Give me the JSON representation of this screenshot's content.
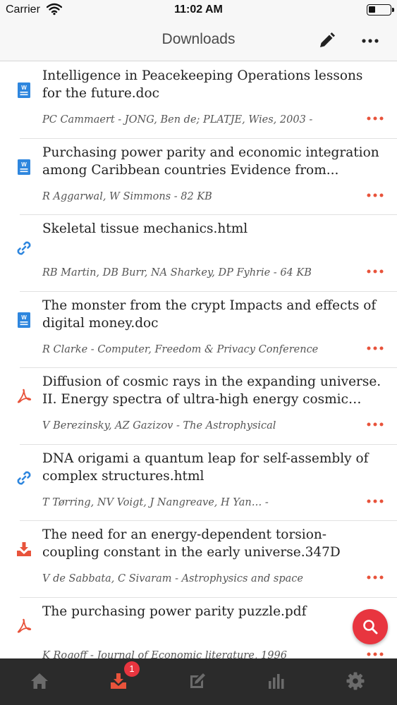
{
  "status_bar": {
    "carrier": "Carrier",
    "time": "11:02 AM"
  },
  "nav": {
    "title": "Downloads",
    "edit_icon": "pencil-icon",
    "more_icon": "more-horizontal-icon"
  },
  "colors": {
    "accent": "#e8533b",
    "fab": "#e8353f",
    "doc_blue": "#2e86de",
    "tabbar": "#2b2b2b"
  },
  "items": [
    {
      "type": "doc",
      "title": " Intelligence in Peacekeeping Operations  lessons for the future.doc",
      "meta": "PC Cammaert - JONG, Ben de; PLATJE, Wies, 2003 -"
    },
    {
      "type": "doc",
      "title": " Purchasing power parity and economic integration among Caribbean countries  Evidence from...",
      "meta": "R Aggarwal, W Simmons - 82 KB"
    },
    {
      "type": "link",
      "title": " Skeletal tissue mechanics.html",
      "meta": "RB Martin, DB Burr, NA Sharkey, DP Fyhrie - 64 KB"
    },
    {
      "type": "doc",
      "title": " The monster from the crypt  Impacts and effects of digital money.doc",
      "meta": "R Clarke - Computer, Freedom & Privacy Conference"
    },
    {
      "type": "pdf",
      "title": "Diffusion of cosmic rays in the expanding universe. II. Energy spectra of ultra-high energy cosmic rays...",
      "meta": "V Berezinsky, AZ Gazizov - The Astrophysical"
    },
    {
      "type": "link",
      "title": "DNA origami  a quantum leap for self-assembly of complex structures.html",
      "meta": "T Tørring, NV Voigt, J Nangreave, H Yan… -"
    },
    {
      "type": "download",
      "title": "The need for an energy-dependent torsion-coupling constant in the early universe.347D",
      "meta": "V de Sabbata, C Sivaram - Astrophysics and space"
    },
    {
      "type": "pdf",
      "title": "The purchasing power parity puzzle.pdf",
      "meta": "K Rogoff - Journal of Economic literature, 1996"
    }
  ],
  "fab": {
    "icon": "search-icon"
  },
  "tabbar": {
    "tabs": [
      {
        "icon": "home-icon",
        "active": false
      },
      {
        "icon": "downloads-icon",
        "active": true,
        "badge": "1"
      },
      {
        "icon": "notes-icon",
        "active": false
      },
      {
        "icon": "stats-icon",
        "active": false
      },
      {
        "icon": "settings-icon",
        "active": false
      }
    ]
  }
}
